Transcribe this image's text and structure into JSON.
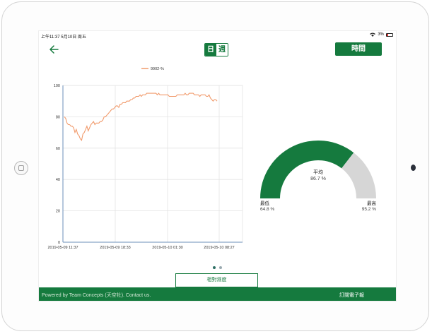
{
  "status_bar": {
    "time_date": "上午11:37   5月10日 周五",
    "battery": "3%"
  },
  "header": {
    "segment": {
      "day": "日",
      "week": "週"
    },
    "time_button": "時間"
  },
  "chart_data": {
    "type": "line",
    "legend": "9902-%",
    "ylim": [
      0,
      100
    ],
    "yticks": [
      0,
      20,
      40,
      60,
      80,
      100
    ],
    "x_ticks": [
      "2019-05-09 11:37",
      "2019-05-09 18:33",
      "2019-05-10 01:30",
      "2019-05-10 08:27"
    ],
    "series": [
      {
        "name": "9902-%",
        "color": "#f19a6b",
        "values": [
          80,
          79,
          76,
          75,
          75,
          74,
          74,
          73,
          70,
          72,
          69,
          68,
          66,
          65,
          69,
          70,
          72,
          74,
          71,
          73,
          75,
          76,
          77,
          75,
          76,
          76,
          76,
          77,
          77,
          78,
          80,
          80,
          81,
          82,
          83,
          84,
          85,
          85,
          86,
          87,
          87,
          86,
          88,
          88,
          89,
          89,
          89,
          90,
          90,
          90,
          91,
          91,
          92,
          92,
          93,
          93,
          93,
          94,
          93,
          94,
          94,
          94,
          95,
          95,
          95,
          95,
          95,
          95,
          95,
          95,
          94,
          95,
          94,
          94,
          94,
          94,
          94,
          94,
          94,
          93,
          93,
          93,
          93,
          93,
          93,
          94,
          94,
          94,
          94,
          94,
          94,
          95,
          94,
          94,
          95,
          95,
          95,
          95,
          94,
          94,
          94,
          94,
          93,
          94,
          94,
          94,
          94,
          93,
          93,
          94,
          92,
          91,
          90,
          91,
          91,
          90
        ]
      }
    ],
    "grid": true
  },
  "gauge": {
    "avg_label": "平均",
    "avg_value": "86.7 %",
    "min_label": "最低",
    "min_value": "64.8 %",
    "max_label": "最高",
    "max_value": "95.2 %",
    "fill_fraction": 0.71,
    "fill_color": "#157a3e",
    "track_color": "#d6d6d6"
  },
  "pager": {
    "count": 2,
    "active": 0
  },
  "tab": {
    "label": "相對濕度"
  },
  "footer": {
    "powered": "Powered by Team Concepts (天空社). Contact us.",
    "subscribe": "訂閱電子報"
  }
}
